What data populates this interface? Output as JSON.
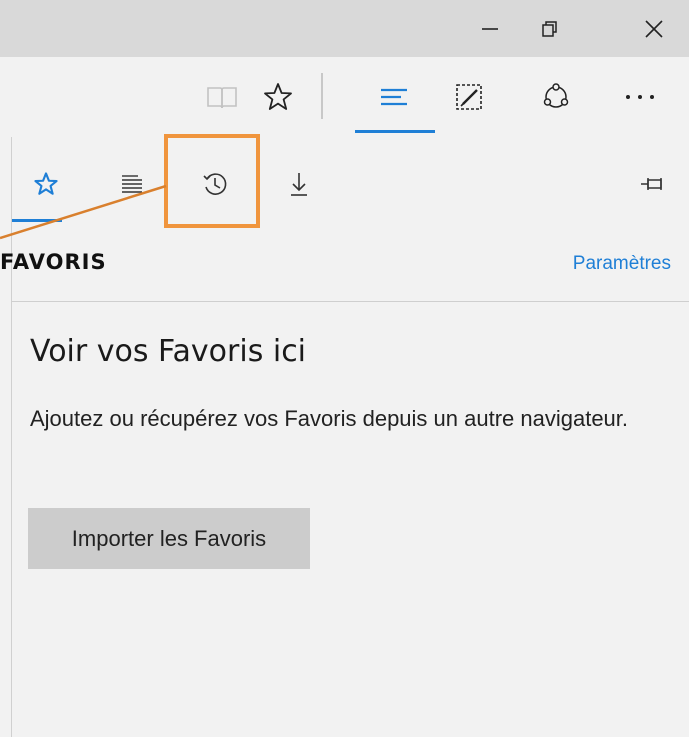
{
  "window_controls": {
    "minimize_icon": "minimize-icon",
    "restore_icon": "restore-icon",
    "close_icon": "close-icon"
  },
  "toolbar": {
    "icons": [
      "reading-view-icon",
      "favorite-star-icon",
      "hub-icon",
      "web-note-icon",
      "share-icon",
      "more-icon"
    ]
  },
  "hub": {
    "tabs": [
      {
        "icon": "favorites-star-icon",
        "selected": true
      },
      {
        "icon": "reading-list-icon",
        "selected": false
      },
      {
        "icon": "history-icon",
        "selected": false,
        "highlighted": true
      },
      {
        "icon": "downloads-icon",
        "selected": false
      }
    ],
    "pin_icon": "pin-icon",
    "section_title": "FAVORIS",
    "settings_link": "Paramètres"
  },
  "main": {
    "heading": "Voir vos Favoris ici",
    "description": "Ajoutez ou récupérez vos Favoris depuis un autre navigateur.",
    "import_button": "Importer les Favoris"
  },
  "colors": {
    "accent": "#1f7fd6",
    "highlight": "#f0953d",
    "titlebar": "#d9d9d9",
    "panel": "#f2f2f2",
    "button": "#cccccc"
  }
}
